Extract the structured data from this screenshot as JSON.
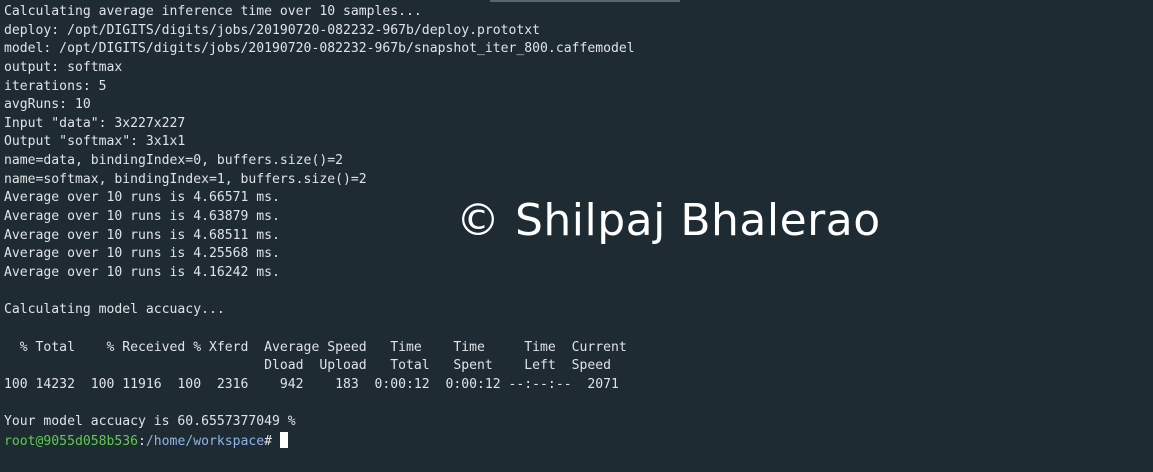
{
  "terminal": {
    "lines": [
      "Calculating average inference time over 10 samples...",
      "deploy: /opt/DIGITS/digits/jobs/20190720-082232-967b/deploy.prototxt",
      "model: /opt/DIGITS/digits/jobs/20190720-082232-967b/snapshot_iter_800.caffemodel",
      "output: softmax",
      "iterations: 5",
      "avgRuns: 10",
      "Input \"data\": 3x227x227",
      "Output \"softmax\": 3x1x1",
      "name=data, bindingIndex=0, buffers.size()=2",
      "name=softmax, bindingIndex=1, buffers.size()=2",
      "Average over 10 runs is 4.66571 ms.",
      "Average over 10 runs is 4.63879 ms.",
      "Average over 10 runs is 4.68511 ms.",
      "Average over 10 runs is 4.25568 ms.",
      "Average over 10 runs is 4.16242 ms.",
      "",
      "Calculating model accuacy...",
      "",
      "  % Total    % Received % Xferd  Average Speed   Time    Time     Time  Current",
      "                                 Dload  Upload   Total   Spent    Left  Speed",
      "100 14232  100 11916  100  2316    942    183  0:00:12  0:00:12 --:--:--  2071",
      "",
      "Your model accuacy is 60.6557377049 %"
    ],
    "prompt": {
      "user_host": "root@9055d058b536",
      "separator": ":",
      "path": "/home/workspace",
      "symbol": "#"
    }
  },
  "watermark": "© Shilpaj Bhalerao"
}
